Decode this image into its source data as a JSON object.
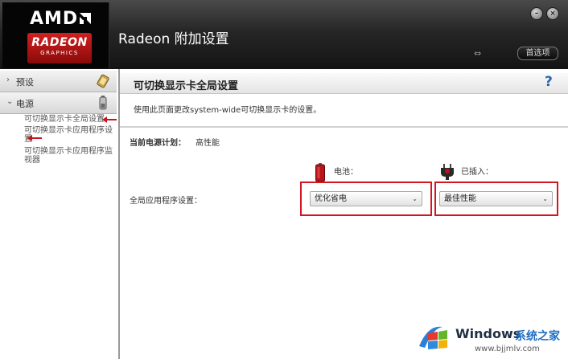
{
  "header": {
    "brand": "AMD",
    "logo_line1": "RADEON",
    "logo_line2": "GRAPHICS",
    "title": "Radeon 附加设置",
    "preferences_label": "首选项",
    "sync_icon_glyph": "⇔"
  },
  "sidebar": {
    "categories": [
      {
        "label": "预设",
        "icon": "preset-icon"
      },
      {
        "label": "电源",
        "icon": "battery-icon"
      }
    ],
    "items": [
      {
        "label": "可切换显示卡全局设置"
      },
      {
        "label": "可切换显示卡应用程序设置"
      },
      {
        "label": "可切换显示卡应用程序监视器"
      }
    ]
  },
  "main": {
    "title": "可切换显示卡全局设置",
    "help_glyph": "?",
    "description": "使用此页面更改system-wide可切换显示卡的设置。",
    "power_plan_label": "当前电源计划：",
    "power_plan_value": "高性能",
    "battery_label": "电池：",
    "plugged_label": "已插入：",
    "global_app_label": "全局应用程序设置：",
    "battery_select": "优化省电",
    "plugged_select": "最佳性能"
  },
  "watermark": {
    "brand": "Windows",
    "cn": "系统之家",
    "url": "www.bjjmlv.com"
  },
  "colors": {
    "highlight_red": "#d21622",
    "header_dark": "#1a1a1a",
    "link_blue": "#2a64b0"
  }
}
